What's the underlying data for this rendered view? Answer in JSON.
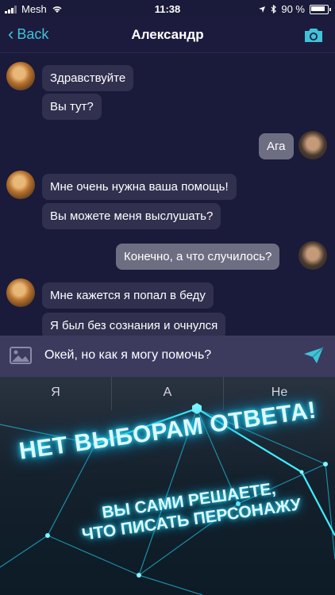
{
  "status_bar": {
    "carrier": "Mesh",
    "time": "11:38",
    "battery": "90 %"
  },
  "header": {
    "back_label": "Back",
    "title": "Александр"
  },
  "messages": [
    {
      "side": "them",
      "text": "Здравствуйте"
    },
    {
      "side": "them",
      "text": "Вы тут?"
    },
    {
      "side": "me",
      "text": "Ага"
    },
    {
      "side": "them",
      "text": "Мне очень нужна ваша помощь!"
    },
    {
      "side": "them",
      "text": "Вы можете меня выслушать?"
    },
    {
      "side": "me",
      "text": "Конечно, а что случилось?"
    },
    {
      "side": "them",
      "text": "Мне кажется я попал в беду"
    },
    {
      "side": "them",
      "text": "Я был без сознания и очнулся"
    }
  ],
  "input": {
    "value": "Окей, но как я могу помочь?"
  },
  "suggestions": [
    "Я",
    "А",
    "Не"
  ],
  "promo": {
    "headline": "НЕТ ВЫБОРАМ ОТВЕТА!",
    "subline_1": "ВЫ САМИ РЕШАЕТЕ,",
    "subline_2": "ЧТО ПИСАТЬ ПЕРСОНАЖУ"
  },
  "colors": {
    "accent": "#3fc3d9",
    "background": "#1a1a3a",
    "bubble_them": "#31304f",
    "bubble_me": "#6e6e82",
    "glow": "#29e3ff"
  }
}
